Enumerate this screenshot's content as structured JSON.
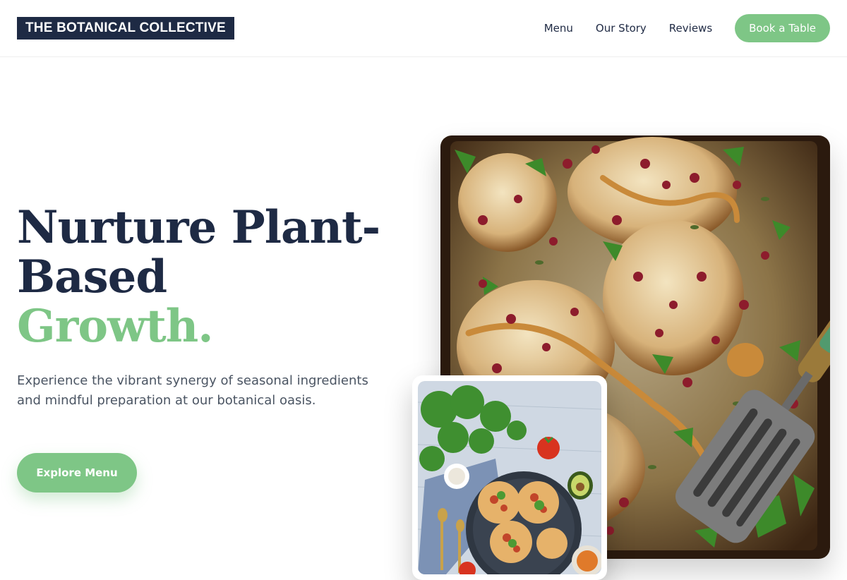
{
  "header": {
    "logo": "THE BOTANICAL COLLECTIVE",
    "nav": [
      "Menu",
      "Our Story",
      "Reviews"
    ],
    "cta": "Book a Table"
  },
  "hero": {
    "title_line1": "Nurture Plant-",
    "title_line2": "Based",
    "title_accent": "Growth.",
    "subtitle": "Experience the vibrant synergy of seasonal ingredients and mindful preparation at our botanical oasis.",
    "button": "Explore Menu"
  },
  "colors": {
    "accent": "#7ec686",
    "navy": "#1e2a44",
    "body_text": "#4b5563"
  },
  "images": {
    "main": "roasted-cauliflower-pomegranate-photo",
    "inset": "tostadas-plate-photo"
  }
}
